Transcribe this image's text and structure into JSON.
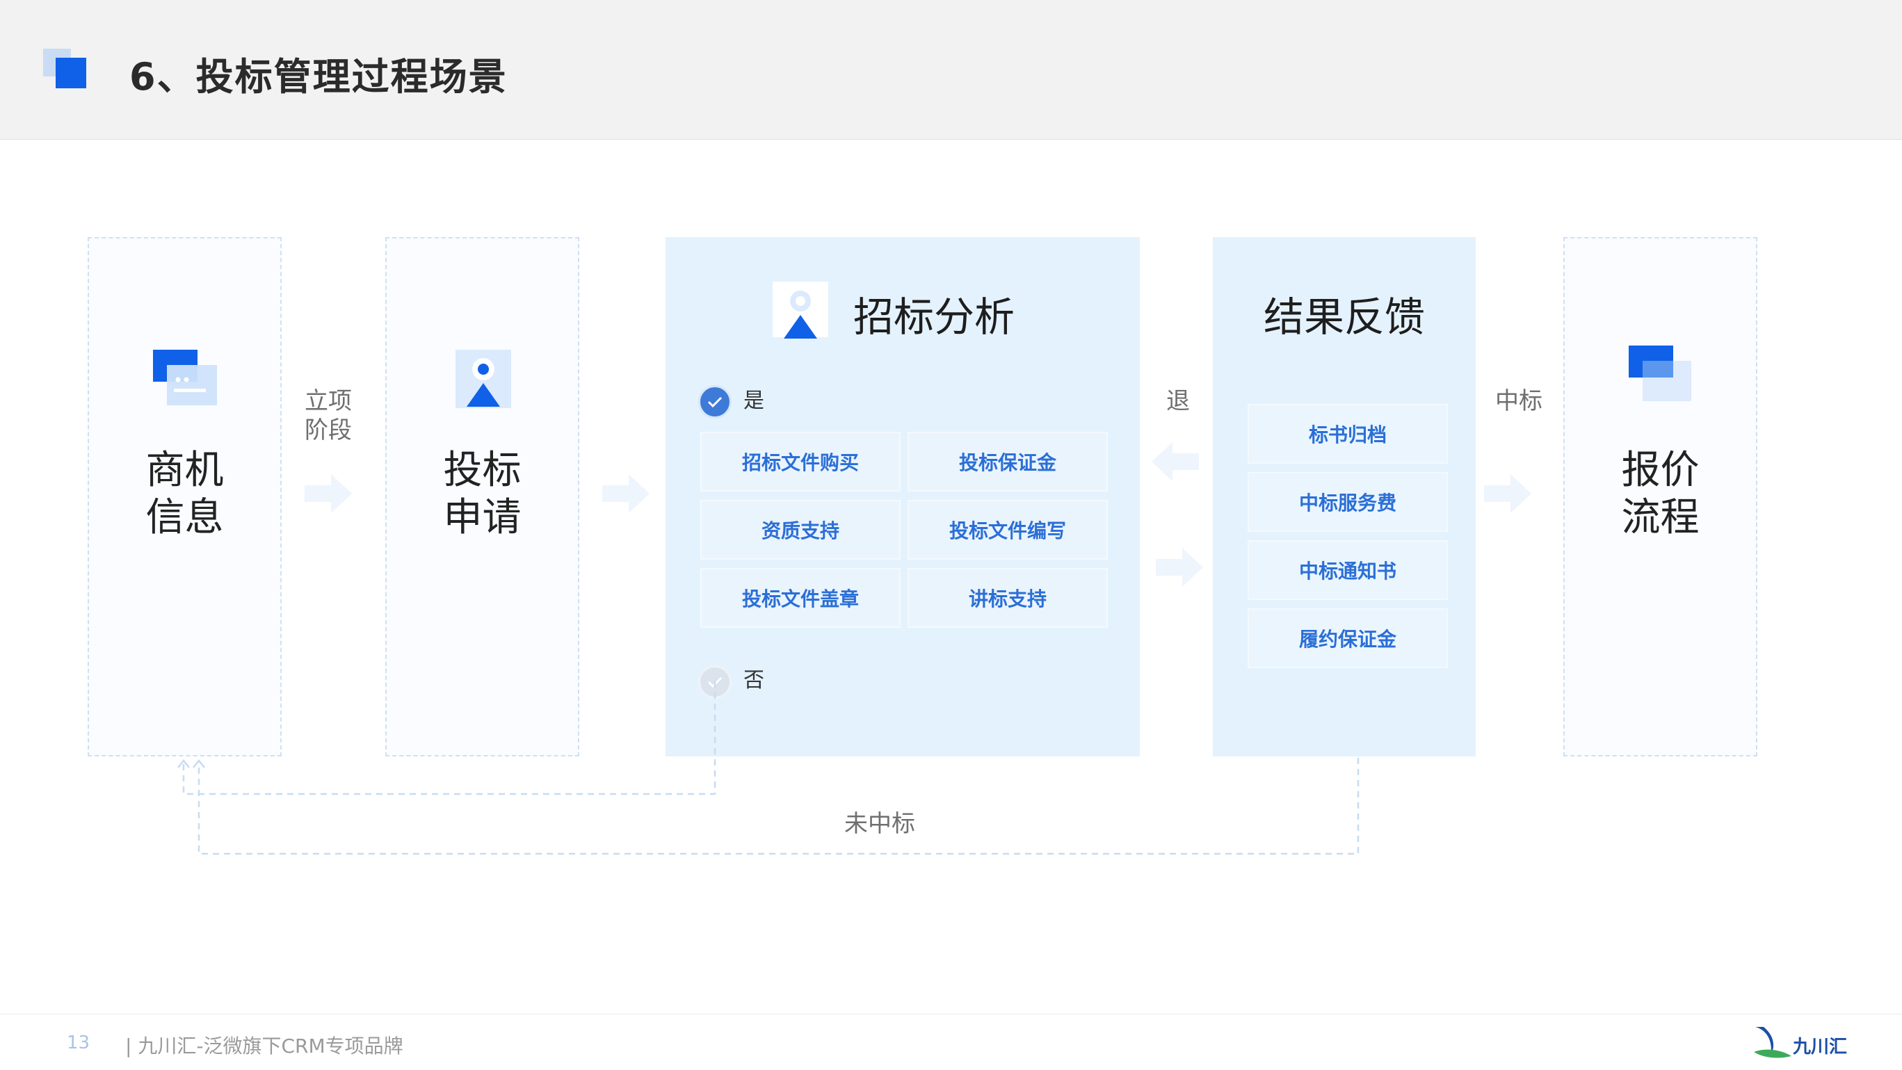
{
  "header": {
    "title": "6、投标管理过程场景"
  },
  "stages": {
    "opportunity": "商机\n信息",
    "bid_apply": "投标\n申请",
    "quote_process": "报价\n流程"
  },
  "connectors": {
    "project_stage": "立项\n阶段",
    "return": "退",
    "win_bid": "中标",
    "lost_bid": "未中标"
  },
  "analysis": {
    "title": "招标分析",
    "yes_label": "是",
    "no_label": "否",
    "items": [
      "招标文件购买",
      "投标保证金",
      "资质支持",
      "投标文件编写",
      "投标文件盖章",
      "讲标支持"
    ]
  },
  "feedback": {
    "title": "结果反馈",
    "items": [
      "标书归档",
      "中标服务费",
      "中标通知书",
      "履约保证金"
    ]
  },
  "footer": {
    "page_number": "13",
    "text": "| 九川汇-泛微旗下CRM专项品牌",
    "brand": "九川汇"
  },
  "colors": {
    "accent": "#1060e8",
    "chip_text": "#2b6fd6",
    "panel_bg": "#e4f2fd",
    "dashed_border": "#cfe0f2"
  }
}
